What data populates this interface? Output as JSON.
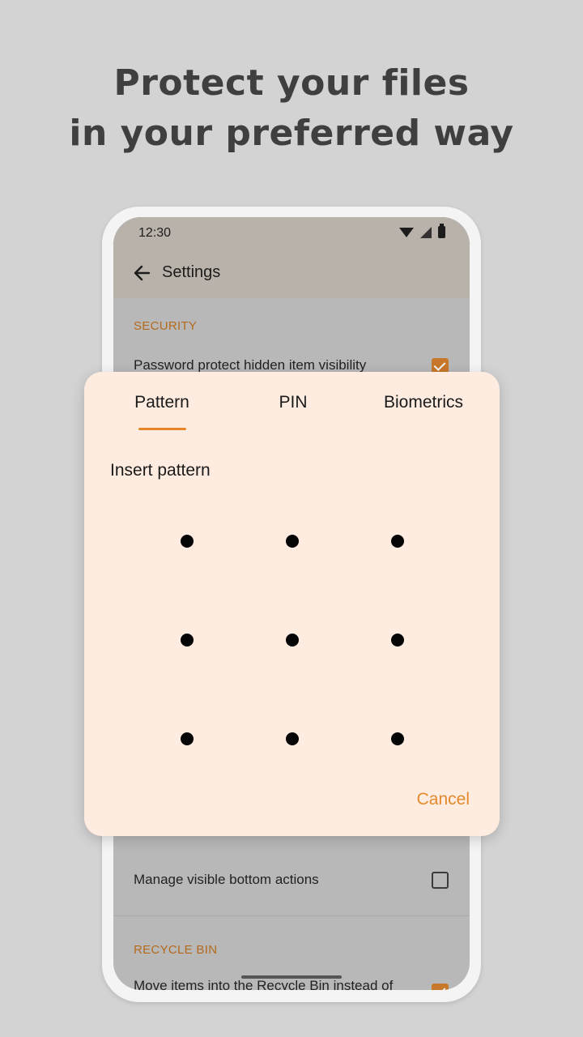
{
  "headline": {
    "line1": "Protect your files",
    "line2": "in your preferred way"
  },
  "status_bar": {
    "time": "12:30",
    "icons": [
      "wifi-icon",
      "cellular-icon",
      "battery-icon"
    ]
  },
  "app_bar": {
    "back_icon": "arrow-left-icon",
    "title": "Settings"
  },
  "settings": {
    "security_label": "SECURITY",
    "password_row": "Password protect hidden item visibility",
    "password_checked": true,
    "bottom_actions_row": "Manage visible bottom actions",
    "bottom_actions_checked": false,
    "recycle_label": "RECYCLE BIN",
    "recycle_row": "Move items into the Recycle Bin instead of"
  },
  "dialog": {
    "tabs": [
      "Pattern",
      "PIN",
      "Biometrics"
    ],
    "active_tab": "Pattern",
    "prompt": "Insert pattern",
    "pattern_grid": "3x3",
    "cancel": "Cancel"
  },
  "colors": {
    "accent": "#e6862a",
    "dialog_bg": "#ffece1",
    "app_bar_bg": "#b9b2aa",
    "page_bg": "#d3d3d3"
  }
}
